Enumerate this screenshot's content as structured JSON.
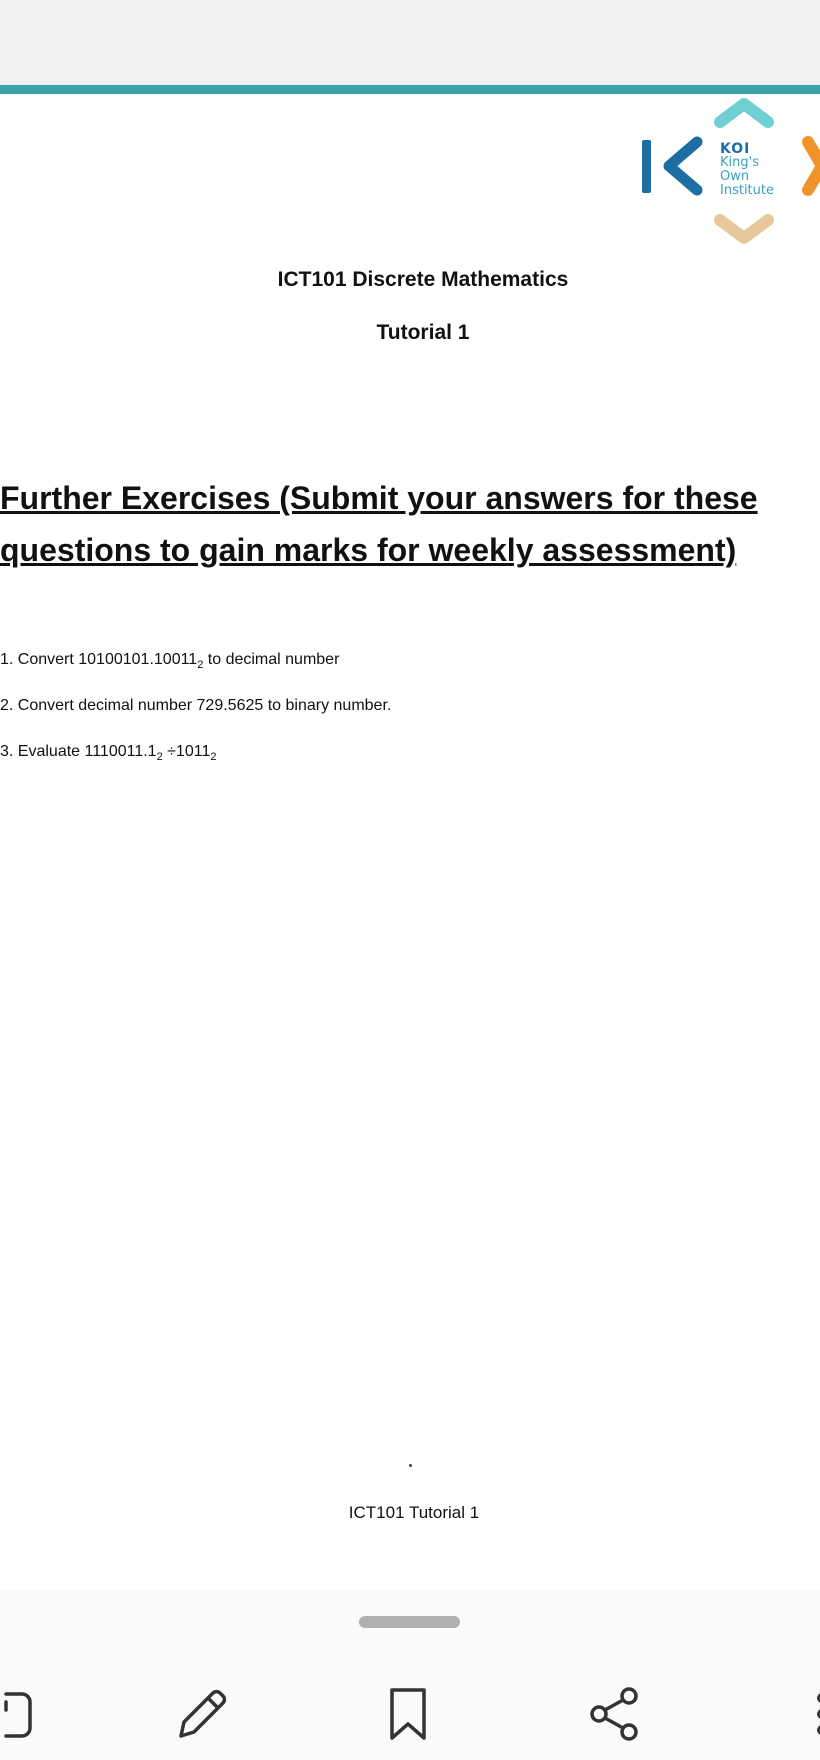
{
  "logo": {
    "line1": "KOI",
    "line2": "King's",
    "line3": "Own",
    "line4": "Institute",
    "colors": {
      "teal": "#6fcfd3",
      "blue": "#1d6ea3",
      "orange": "#f0932b",
      "beige": "#e6c89c"
    }
  },
  "document": {
    "title": "ICT101 Discrete Mathematics",
    "subtitle": "Tutorial 1",
    "heading_line1": "Further Exercises (Submit your answers for these",
    "heading_line2": "questions to gain marks for weekly assessment)",
    "questions": [
      {
        "prefix": "1. Convert 10100101.10011",
        "sub": "2",
        "suffix": " to decimal number"
      },
      {
        "text": "2. Convert decimal number 729.5625 to binary number."
      },
      {
        "prefix": "3. Evaluate 1110011.1",
        "sub1": "2",
        "middle": " ÷1011",
        "sub2": "2"
      }
    ],
    "footer": "ICT101 Tutorial 1"
  },
  "toolbar": {
    "items": [
      "copy-icon",
      "pencil-icon",
      "bookmark-icon",
      "share-icon",
      "more-icon"
    ]
  },
  "colors": {
    "accent": "#3aa3a8",
    "handle": "#b0b0b0"
  }
}
